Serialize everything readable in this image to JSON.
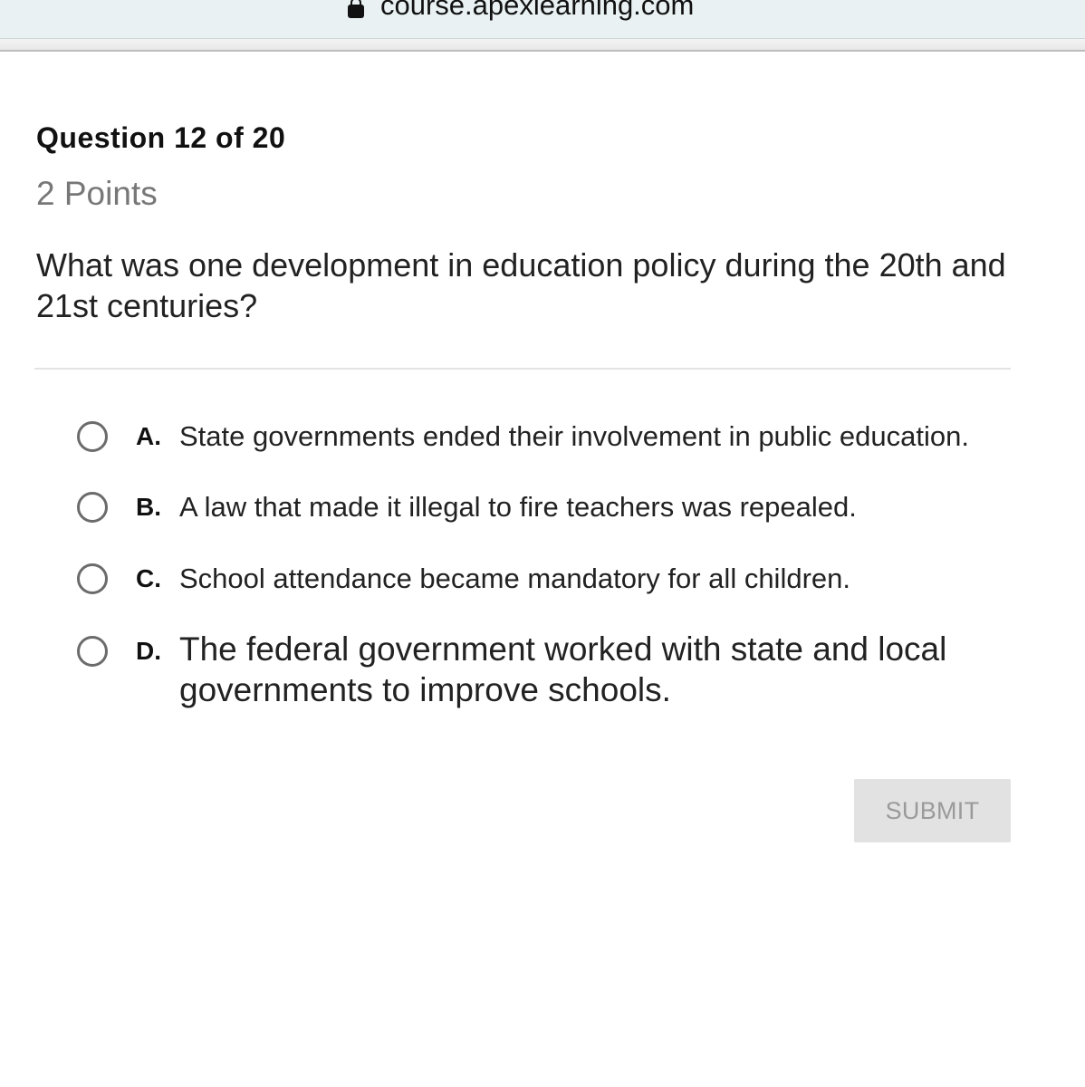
{
  "browser": {
    "url": "course.apexlearning.com",
    "lock_icon": "lock-icon"
  },
  "question": {
    "title": "Question 12 of 20",
    "points": "2 Points",
    "text": "What was one development in education policy during the 20th and 21st centuries?"
  },
  "options": [
    {
      "letter": "A.",
      "text": "State governments ended their involvement in public education.",
      "selected": false
    },
    {
      "letter": "B.",
      "text": "A law that made it illegal to fire teachers was repealed.",
      "selected": false
    },
    {
      "letter": "C.",
      "text": "School attendance became mandatory for all children.",
      "selected": false
    },
    {
      "letter": "D.",
      "text": "The federal government worked with state and local governments to improve schools.",
      "selected": false
    }
  ],
  "submit": {
    "label": "SUBMIT",
    "enabled": false
  }
}
